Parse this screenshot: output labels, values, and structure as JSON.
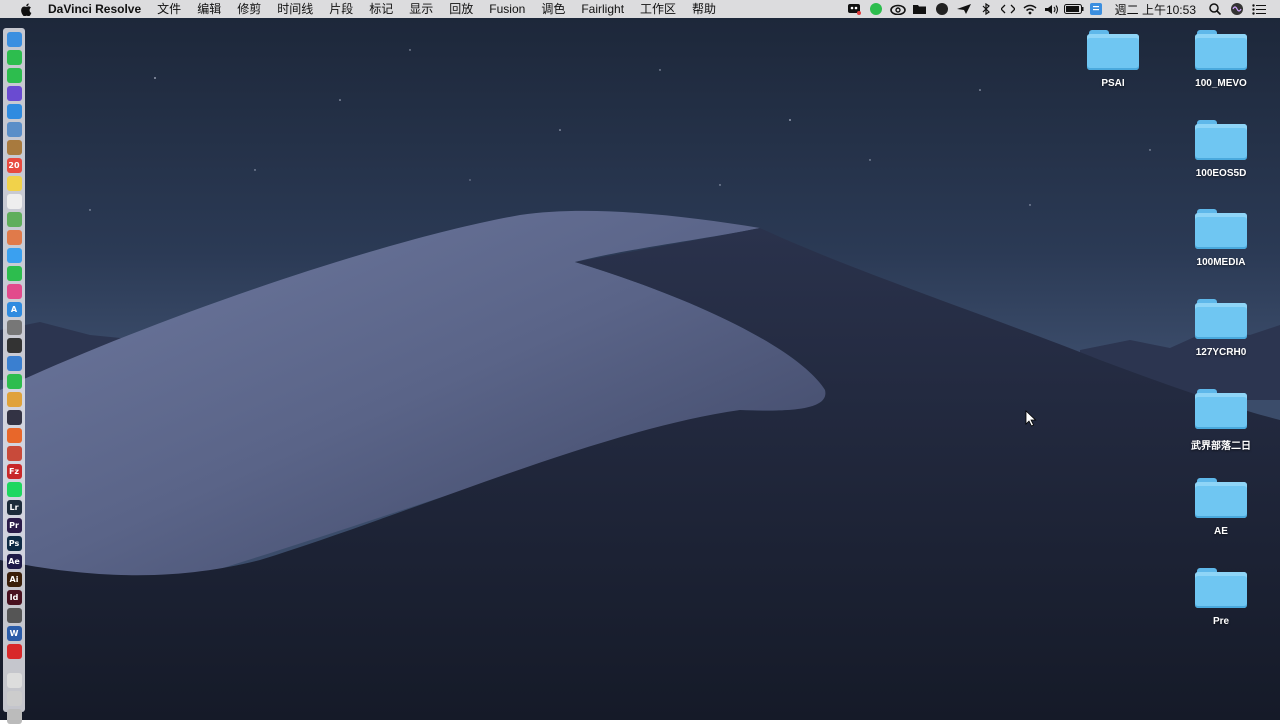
{
  "menubar": {
    "app_name": "DaVinci Resolve",
    "menus": [
      "文件",
      "编辑",
      "修剪",
      "时间线",
      "片段",
      "标记",
      "显示",
      "回放",
      "Fusion",
      "调色",
      "Fairlight",
      "工作区",
      "帮助"
    ],
    "clock": "週二 上午10:53"
  },
  "status_icons": [
    "robot-icon",
    "line-icon",
    "creative-cloud-icon",
    "folder-icon",
    "evernote-icon",
    "airmail-icon",
    "bluetooth-icon",
    "code-icon",
    "wifi-icon",
    "volume-icon",
    "battery-icon",
    "input-method-icon"
  ],
  "desktop": {
    "folders": [
      {
        "label": "PSAI"
      },
      {
        "label": "100_MEVO"
      },
      {
        "label": "100EOS5D"
      },
      {
        "label": "100MEDIA"
      },
      {
        "label": "127YCRH0"
      },
      {
        "label": "武界部落二日"
      },
      {
        "label": "AE"
      },
      {
        "label": "Pre"
      }
    ]
  },
  "dock": {
    "apps": [
      {
        "name": "finder-icon",
        "text": "",
        "color": "#3b8fe0"
      },
      {
        "name": "line-app-icon",
        "text": "",
        "color": "#2dbd4e"
      },
      {
        "name": "wechat-icon",
        "text": "",
        "color": "#2dbd4e"
      },
      {
        "name": "siri-icon",
        "text": "",
        "color": "#6a4bd1"
      },
      {
        "name": "safari-icon",
        "text": "",
        "color": "#2f8be0"
      },
      {
        "name": "preview-icon",
        "text": "",
        "color": "#5a8ec8"
      },
      {
        "name": "notes-brown-icon",
        "text": "",
        "color": "#a87a3e"
      },
      {
        "name": "calendar-icon",
        "text": "20",
        "color": "#e84a3f"
      },
      {
        "name": "stickies-icon",
        "text": "",
        "color": "#f1d24a"
      },
      {
        "name": "textedit-icon",
        "text": "",
        "color": "#eeeeee"
      },
      {
        "name": "maps-icon",
        "text": "",
        "color": "#5fae5c"
      },
      {
        "name": "photos-icon",
        "text": "",
        "color": "#e07a4a"
      },
      {
        "name": "messages-icon",
        "text": "",
        "color": "#3aa0f0"
      },
      {
        "name": "facetime-icon",
        "text": "",
        "color": "#2dbd4e"
      },
      {
        "name": "itunes-icon",
        "text": "",
        "color": "#e24a8c"
      },
      {
        "name": "app-store-icon",
        "text": "A",
        "color": "#2f8be0"
      },
      {
        "name": "system-preferences-icon",
        "text": "",
        "color": "#777777"
      },
      {
        "name": "aperture-icon",
        "text": "",
        "color": "#333333"
      },
      {
        "name": "keynote-icon",
        "text": "",
        "color": "#3a7fd0"
      },
      {
        "name": "evernote-app-icon",
        "text": "",
        "color": "#2dbd4e"
      },
      {
        "name": "chrome-icon",
        "text": "",
        "color": "#e0a23a"
      },
      {
        "name": "davinci-resolve-icon",
        "text": "",
        "color": "#333344"
      },
      {
        "name": "firefox-icon",
        "text": "",
        "color": "#e8672a"
      },
      {
        "name": "handbrake-icon",
        "text": "",
        "color": "#c84a3a"
      },
      {
        "name": "filezilla-icon",
        "text": "Fz",
        "color": "#c8282a"
      },
      {
        "name": "spotify-icon",
        "text": "",
        "color": "#1ed760"
      },
      {
        "name": "lightroom-icon",
        "text": "Lr",
        "color": "#1c2b3a"
      },
      {
        "name": "premiere-icon",
        "text": "Pr",
        "color": "#2a1a48"
      },
      {
        "name": "photoshop-icon",
        "text": "Ps",
        "color": "#0e2a44"
      },
      {
        "name": "after-effects-icon",
        "text": "Ae",
        "color": "#1e1a48"
      },
      {
        "name": "illustrator-icon",
        "text": "Ai",
        "color": "#3a1e08"
      },
      {
        "name": "indesign-icon",
        "text": "Id",
        "color": "#48101e"
      },
      {
        "name": "phone-backup-icon",
        "text": "",
        "color": "#555555"
      },
      {
        "name": "word-icon",
        "text": "W",
        "color": "#2b5ca8"
      },
      {
        "name": "antivirus-icon",
        "text": "",
        "color": "#d8282a"
      }
    ],
    "bottom": [
      {
        "name": "downloads-stack-icon",
        "text": "",
        "color": "#dddddd"
      },
      {
        "name": "documents-stack-icon",
        "text": "",
        "color": "#cccccc"
      },
      {
        "name": "trash-icon",
        "text": "",
        "color": "#bbbbbb"
      }
    ]
  }
}
